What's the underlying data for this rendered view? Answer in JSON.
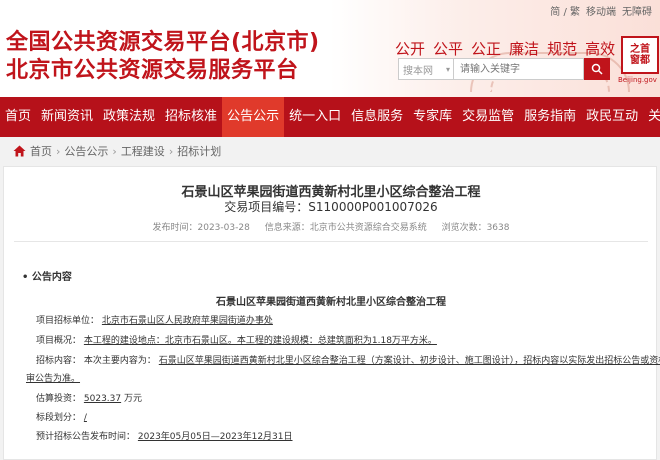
{
  "header": {
    "title_line1": "全国公共资源交易平台(北京市)",
    "title_line2": "北京市公共资源交易服务平台",
    "top_links": [
      "简 / 繁",
      "移动端",
      "无障碍"
    ],
    "values": [
      "公开",
      "公平",
      "公正",
      "廉洁",
      "规范",
      "高效"
    ],
    "search_scope": "搜本网",
    "search_placeholder": "请输入关键字",
    "seal_line1": "之首",
    "seal_line2": "窗都",
    "seal_sub": "Beijing.gov"
  },
  "nav": {
    "items": [
      "首页",
      "新闻资讯",
      "政策法规",
      "招标核准",
      "公告公示",
      "统一入口",
      "信息服务",
      "专家库",
      "交易监管",
      "服务指南",
      "政民互动",
      "关于中"
    ],
    "active_index": 4
  },
  "breadcrumb": [
    "首页",
    "公告公示",
    "工程建设",
    "招标计划"
  ],
  "article": {
    "title": "石景山区苹果园街道西黄新村北里小区综合整治工程",
    "project_no": "交易项目编号：S110000P001007026",
    "date": "发布时间：2023-03-28",
    "source": "信息来源：北京市公共资源综合交易系统",
    "views": "浏览次数：3638",
    "section_head": "• 公告内容",
    "section_title": "石景山区苹果园街道西黄新村北里小区综合整治工程",
    "tenderer_label": "项目招标单位：",
    "tenderer_value": "北京市石景山区人民政府苹果园街道办事处",
    "overview_label": "项目概况：",
    "overview_value": "本工程的建设地点：北京市石景山区。本工程的建设规模：总建筑面积为1.18万平方米。",
    "content_label": "招标内容：",
    "content_prefix": "本次主要内容为：",
    "content_value": "石景山区苹果园街道西黄新村北里小区综合整治工程（方案设计、初步设计、施工图设计），招标内容以实际发出招标公告或资格预",
    "content_cont": "审公告为准。",
    "investment_label": "估算投资：",
    "investment_value": "5023.37",
    "investment_unit": "万元",
    "lot_label": "标段划分：",
    "lot_value": "/",
    "time_label": "预计招标公告发布时间：",
    "time_value": "2023年05月05日—2023年12月31日"
  },
  "colors": {
    "brand_red": "#c0141b",
    "nav_red": "#b6111a",
    "nav_active": "#e03a2b"
  }
}
